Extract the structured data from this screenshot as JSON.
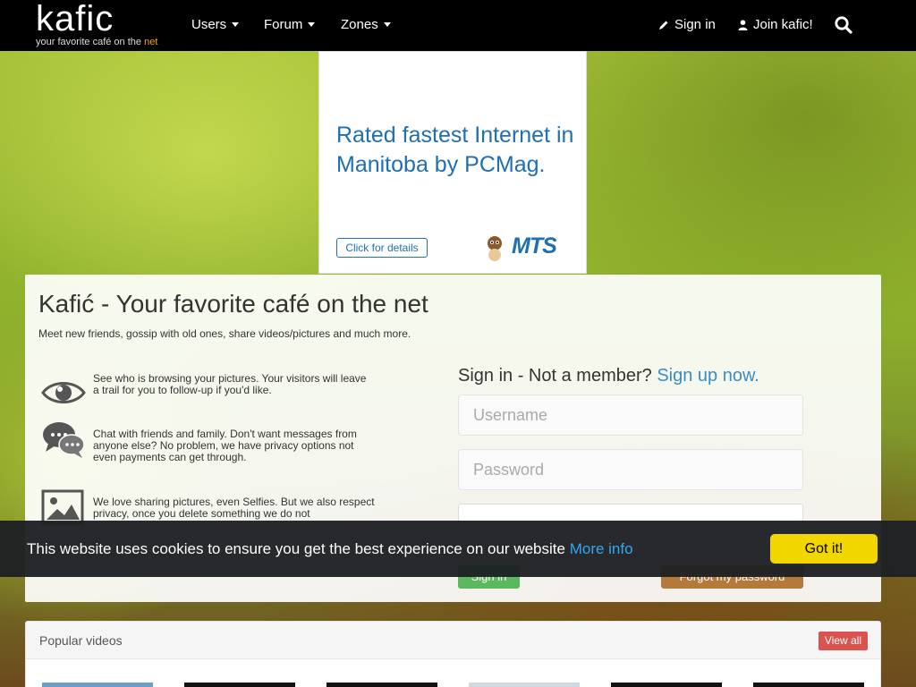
{
  "nav": {
    "logo_word": "kafic",
    "logo_tag_main": "your favorite café on the ",
    "logo_tag_accent": "net",
    "users": "Users",
    "forum": "Forum",
    "zones": "Zones",
    "sign_in": "Sign in",
    "join": "Join kafic!"
  },
  "ad": {
    "headline": "Rated fastest Internet in Manitoba by PCMag.",
    "button": "Click for details",
    "brand": "MTS",
    "brand_color": "#1f6fb2"
  },
  "panel": {
    "title": "Kafić - Your favorite café on the net",
    "subtitle": "Meet new friends, gossip with old ones, share videos/pictures and much more.",
    "features": [
      {
        "icon": "eye-icon",
        "text": "See who is browsing your pictures. Your visitors will leave a trail for you to follow-up if you'd like."
      },
      {
        "icon": "chat-icon",
        "text": "Chat with friends and family. Don't want messages from anyone else? No problem, we have privacy options not even payments can get through."
      },
      {
        "icon": "picture-icon",
        "text": "We love sharing pictures, even Selfies. But we also respect privacy, once you delete something we do not"
      }
    ]
  },
  "signin": {
    "head": "Sign in - Not a member?",
    "signup_link": "Sign up now.",
    "username_placeholder": "Username",
    "password_placeholder": "Password",
    "submit": "Sign in",
    "forgot": "Forgot my password"
  },
  "cookie": {
    "message": "This website uses cookies to ensure you get the best experience on our website",
    "more_info": "More info",
    "accept": "Got it!",
    "accept_color": "#f1d600"
  },
  "videos": {
    "title": "Popular videos",
    "view_all": "View all"
  }
}
